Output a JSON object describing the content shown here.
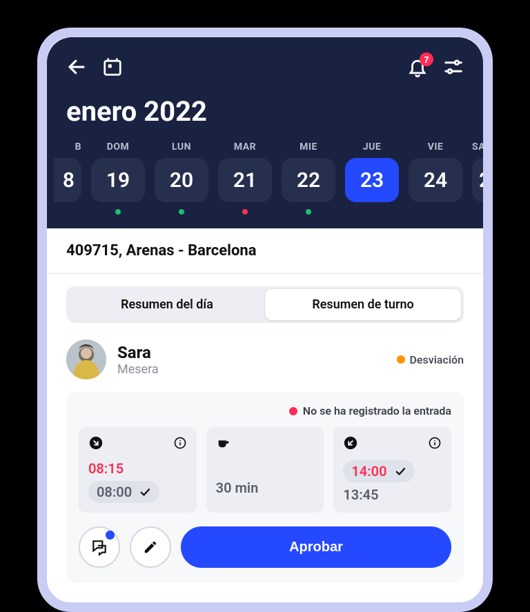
{
  "header": {
    "month_title": "enero 2022",
    "notification_count": "7"
  },
  "week": {
    "days": [
      {
        "label": "B",
        "num": "8",
        "selected": false,
        "dot": "none",
        "edge": "left"
      },
      {
        "label": "DOM",
        "num": "19",
        "selected": false,
        "dot": "green",
        "edge": ""
      },
      {
        "label": "LUN",
        "num": "20",
        "selected": false,
        "dot": "green",
        "edge": ""
      },
      {
        "label": "MAR",
        "num": "21",
        "selected": false,
        "dot": "red",
        "edge": ""
      },
      {
        "label": "MIE",
        "num": "22",
        "selected": false,
        "dot": "green",
        "edge": ""
      },
      {
        "label": "JUE",
        "num": "23",
        "selected": true,
        "dot": "none",
        "edge": ""
      },
      {
        "label": "VIE",
        "num": "24",
        "selected": false,
        "dot": "none",
        "edge": ""
      },
      {
        "label": "SA",
        "num": "2",
        "selected": false,
        "dot": "none",
        "edge": "right"
      }
    ]
  },
  "location": {
    "text": "409715, Arenas - Barcelona"
  },
  "tabs": {
    "day_summary": "Resumen del día",
    "shift_summary": "Resumen de turno"
  },
  "employee": {
    "name": "Sara",
    "role": "Mesera",
    "deviation_label": "Desviación"
  },
  "card": {
    "alert_text": "No se ha registrado la entrada",
    "clock_in": {
      "actual": "08:15",
      "scheduled": "08:00"
    },
    "break": {
      "duration": "30 min"
    },
    "clock_out": {
      "actual": "14:00",
      "scheduled": "13:45"
    },
    "approve_label": "Aprobar"
  }
}
